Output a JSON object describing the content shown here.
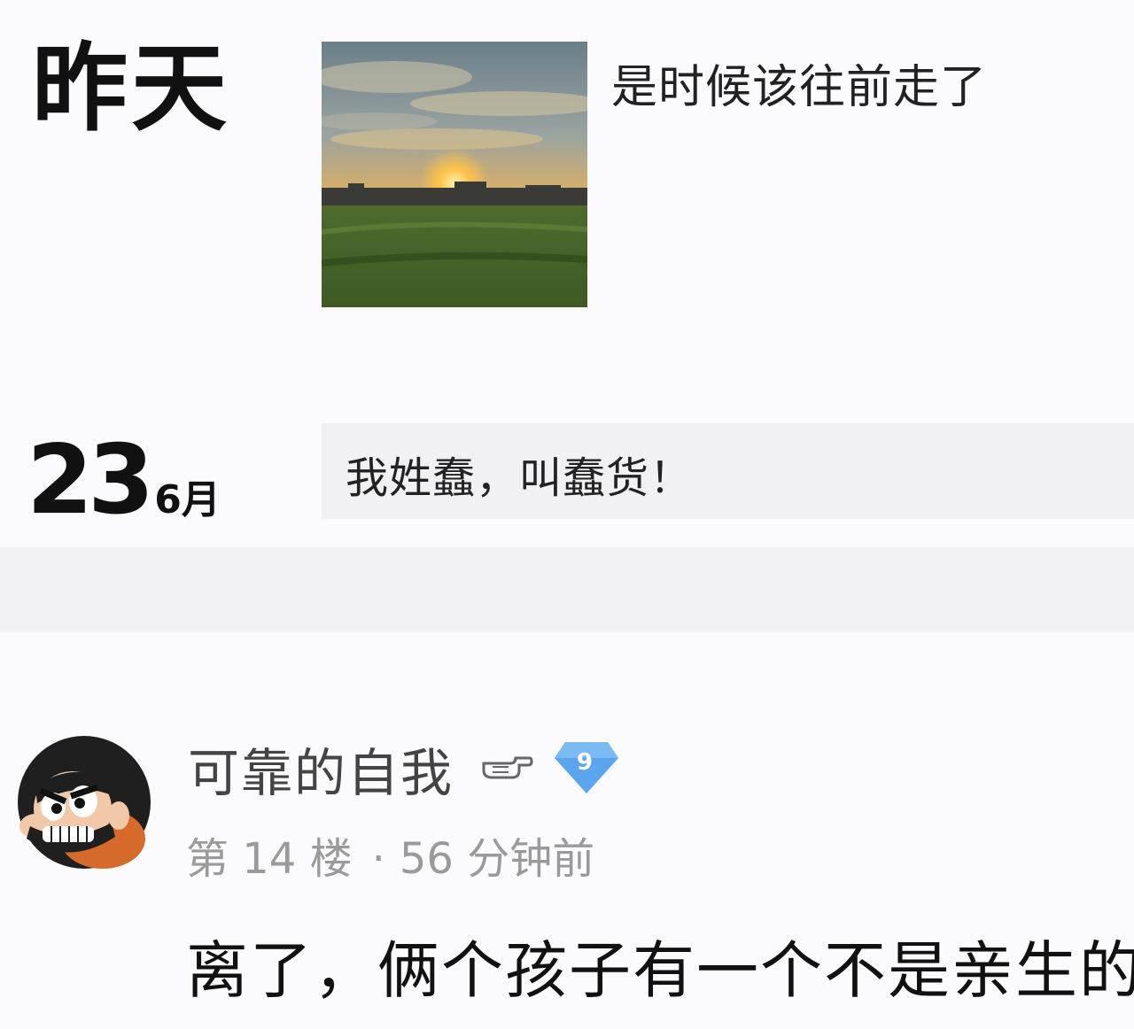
{
  "moment_1": {
    "day_label": "昨天",
    "text": "是时候该往前走了"
  },
  "moment_2": {
    "day": "23",
    "month": "6月",
    "text": "我姓蠢，叫蠢货！"
  },
  "comment": {
    "username": "可靠的自我",
    "level": "9",
    "floor": "第 14 楼",
    "separator": "·",
    "time": "56 分钟前",
    "text": "离了，俩个孩子有一个不是亲生的"
  },
  "icons": {
    "photo": "sunset-photo",
    "avatar": "cartoon-avatar",
    "hand": "pointing-hand-icon",
    "badge": "diamond-level-badge-icon"
  },
  "colors": {
    "background": "#fbfbfd",
    "card": "#f1f1f3",
    "meta_text": "#9a9a9a",
    "badge": "#5aa5ee"
  }
}
